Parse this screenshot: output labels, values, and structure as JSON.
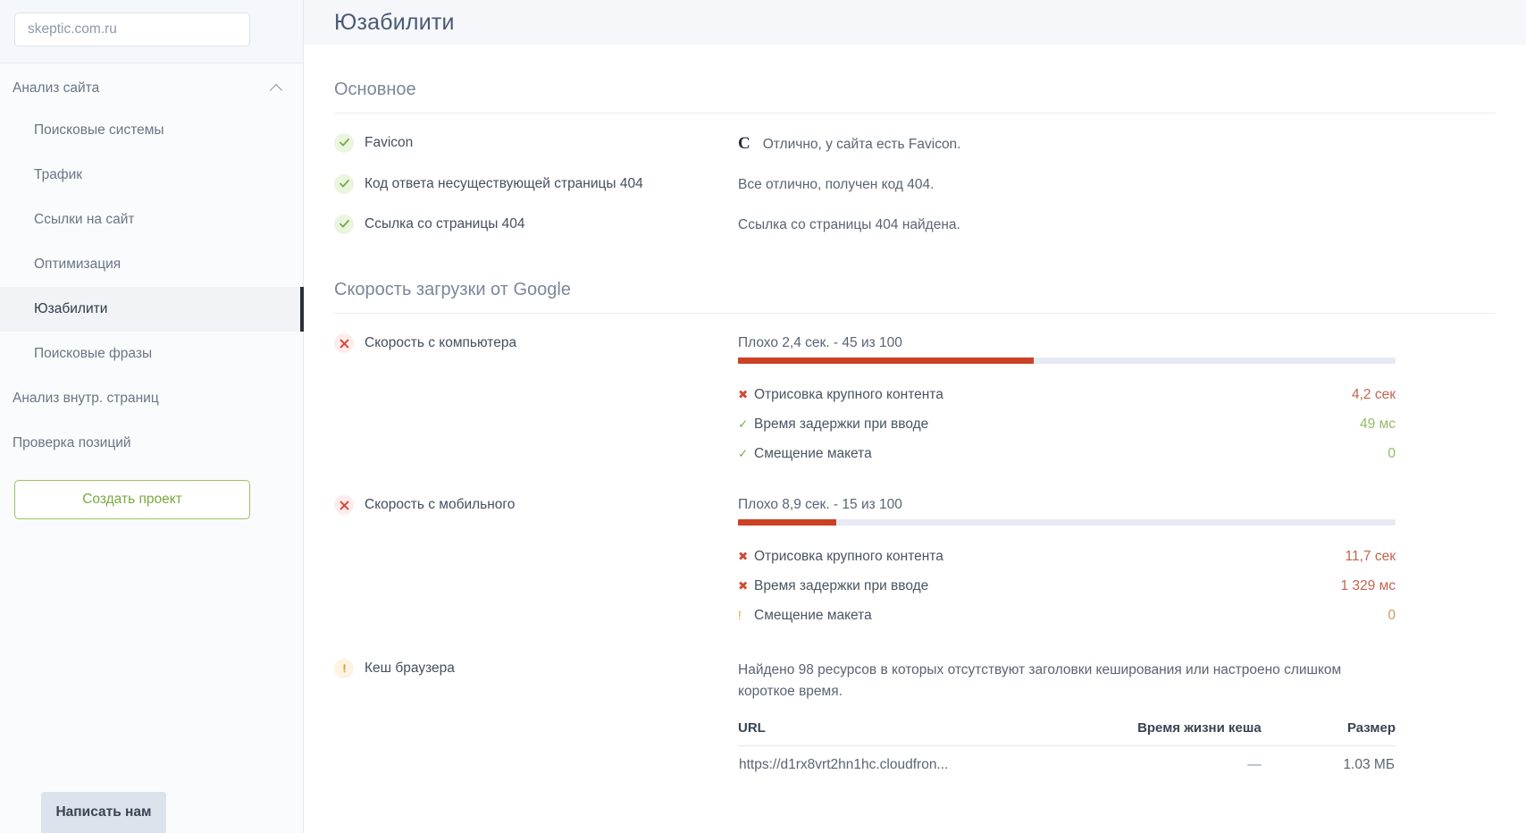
{
  "sidebar": {
    "site_input": {
      "value": "skeptic.com.ru",
      "placeholder": "skeptic.com.ru"
    },
    "group": {
      "label": "Анализ сайта",
      "expanded": true
    },
    "sub_items": [
      {
        "label": "Поисковые системы",
        "active": false
      },
      {
        "label": "Трафик",
        "active": false
      },
      {
        "label": "Ссылки на сайт",
        "active": false
      },
      {
        "label": "Оптимизация",
        "active": false
      },
      {
        "label": "Юзабилити",
        "active": true
      },
      {
        "label": "Поисковые фразы",
        "active": false
      }
    ],
    "top_items": [
      {
        "label": "Анализ внутр. страниц"
      },
      {
        "label": "Проверка позиций"
      }
    ],
    "create_button": "Создать проект",
    "write_us_button": "Написать нам"
  },
  "header": {
    "title": "Юзабилити"
  },
  "sections": {
    "basic": {
      "title": "Основное",
      "rows": [
        {
          "status": "ok",
          "label": "Favicon",
          "favicon_glyph": "C",
          "text": "Отлично, у сайта есть Favicon."
        },
        {
          "status": "ok",
          "label": "Код ответа несуществующей страницы 404",
          "text": "Все отлично, получен код 404."
        },
        {
          "status": "ok",
          "label": "Ссылка со страницы 404",
          "text": "Ссылка со страницы 404 найдена."
        }
      ]
    },
    "speed": {
      "title": "Скорость загрузки от Google",
      "rows": [
        {
          "status": "bad",
          "label": "Скорость с компьютера",
          "bar_label": "Плохо 2,4 сек. - 45 из 100",
          "score": 45,
          "score_max": 100,
          "bar_color": "#ca4125",
          "metrics": [
            {
              "status": "bad",
              "name": "Отрисовка крупного контента",
              "value": "4,2 сек",
              "value_state": "bad"
            },
            {
              "status": "ok",
              "name": "Время задержки при вводе",
              "value": "49 мс",
              "value_state": "ok"
            },
            {
              "status": "ok",
              "name": "Смещение макета",
              "value": "0",
              "value_state": "ok"
            }
          ]
        },
        {
          "status": "bad",
          "label": "Скорость с мобильного",
          "bar_label": "Плохо 8,9 сек. - 15 из 100",
          "score": 15,
          "score_max": 100,
          "bar_color": "#ca4125",
          "metrics": [
            {
              "status": "bad",
              "name": "Отрисовка крупного контента",
              "value": "11,7 сек",
              "value_state": "bad"
            },
            {
              "status": "bad",
              "name": "Время задержки при вводе",
              "value": "1 329 мс",
              "value_state": "bad"
            },
            {
              "status": "warn",
              "name": "Смещение макета",
              "value": "0",
              "value_state": "warn"
            }
          ]
        },
        {
          "status": "warn",
          "label": "Кеш браузера",
          "text": "Найдено 98 ресурсов в которых отсутствуют заголовки кеширования или настроено слишком короткое время.",
          "table": {
            "columns": [
              "URL",
              "Время жизни кеша",
              "Размер"
            ],
            "rows": [
              {
                "url": "https://d1rx8vrt2hn1hc.cloudfron...",
                "life": "—",
                "size": "1.03 МБ"
              }
            ]
          }
        }
      ]
    }
  },
  "colors": {
    "ok": "#7fae45",
    "bad": "#cf4a36",
    "warn": "#dba23f",
    "bar": "#ca4125",
    "accent_border": "#2b2f36"
  }
}
